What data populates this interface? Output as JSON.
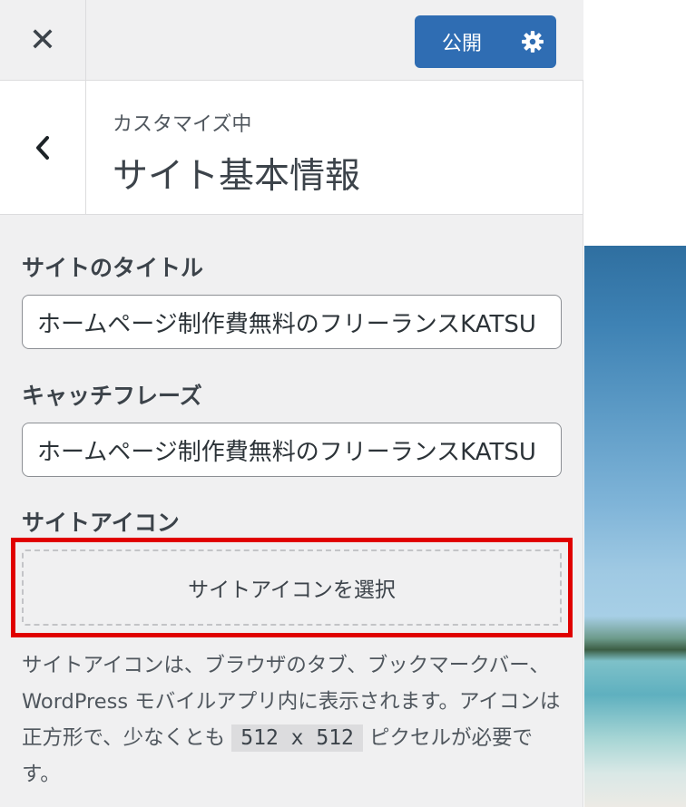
{
  "header": {
    "close_icon": "close-icon",
    "publish_label": "公開",
    "settings_icon": "gear-icon"
  },
  "section": {
    "back_icon": "chevron-left-icon",
    "subtitle": "カスタマイズ中",
    "title": "サイト基本情報"
  },
  "site_title": {
    "label": "サイトのタイトル",
    "value": "ホームページ制作費無料のフリーランスKATSU"
  },
  "tagline": {
    "label": "キャッチフレーズ",
    "value": "ホームページ制作費無料のフリーランスKATSU"
  },
  "site_icon": {
    "label": "サイトアイコン",
    "button_label": "サイトアイコンを選択",
    "description_part1": "サイトアイコンは、ブラウザのタブ、ブックマークバー、WordPress モバイルアプリ内に表示されます。アイコンは正方形で、少なくとも",
    "size_code": "512 x 512",
    "description_part2": "ピクセルが必要です。"
  },
  "colors": {
    "accent": "#2f6db3",
    "highlight": "#e00000"
  }
}
